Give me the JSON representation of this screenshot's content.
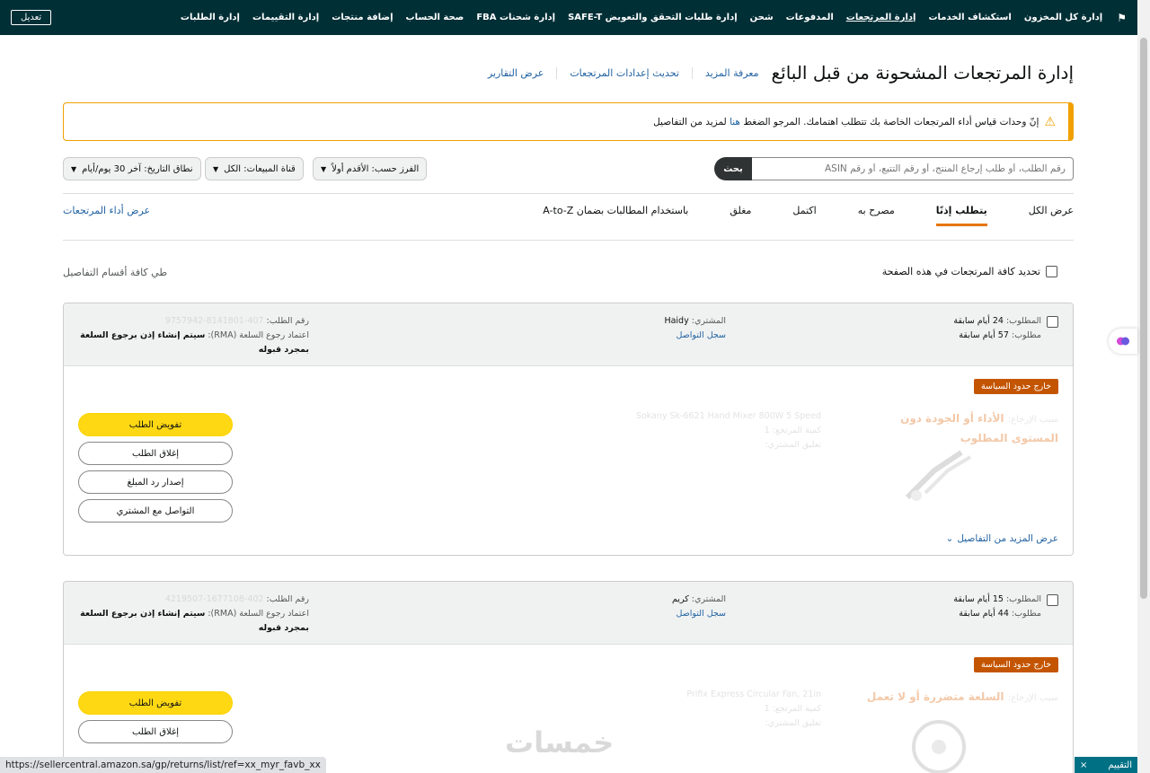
{
  "topnav": {
    "items": [
      "إدارة كل المخزون",
      "استكشاف الخدمات",
      "إدارة المرتجعات",
      "المدفوعات",
      "شحن",
      "إدارة طلبات التحقق والتعويض SAFE-T",
      "إدارة شحنات FBA",
      "صحة الحساب",
      "إضافة منتجات",
      "إدارة التقييمات",
      "إدارة الطلبات"
    ],
    "edit_label": "تعديل"
  },
  "header": {
    "title": "إدارة المرتجعات المشحونة من قبل البائع",
    "learn_more": "معرفة المزيد",
    "update_settings": "تحديث إعدادات المرتجعات",
    "view_reports": "عرض التقارير"
  },
  "alert": {
    "text_before": "إنّ وحدات قياس أداء المرتجعات الخاصة بك تتطلب اهتمامك. المرجو الضغط",
    "link": "هنا",
    "text_after": "لمزيد من التفاصيل"
  },
  "search": {
    "placeholder": "رقم الطلب، أو طلب إرجاع المنتج، أو رقم التتبع، أو رقم ASIN",
    "button": "بحث"
  },
  "filters": {
    "sort": "الفرز حسب: الأقدم أولاً",
    "channel": "قناة المبيعات: الكل",
    "date_range": "نطاق التاريخ: آخر 30 يوم/أيام"
  },
  "tabs": [
    "عرض الكل",
    "يتطلب إذنًا",
    "مصرح به",
    "اكتمل",
    "مغلق",
    "باستخدام المطالبات بضمان A-to-Z"
  ],
  "tab_perf": "عرض أداء المرتجعات",
  "select_all": "تحديد كافة المرتجعات في هذه الصفحة",
  "collapse_all": "طي كافة أقسام التفاصيل",
  "cards": [
    {
      "requested_label": "المطلوب:",
      "requested_value": "24 أيام سابقة",
      "requested2_label": "مطلوب:",
      "requested2_value": "57 أيام سابقة",
      "buyer_label": "المشتري:",
      "buyer_value": "Haidy",
      "contact_history": "سجل التواصل",
      "order_label": "رقم الطلب:",
      "order_value": "407-8141801-9757942",
      "rma_label": "اعتماد رجوع السلعة (RMA):",
      "rma_value": "سيتم إنشاء إذن برجوع السلعة بمجرد قبوله",
      "policy_badge": "خارج حدود السياسة",
      "reason_label": "سبب الإرجاع:",
      "reason_value": "الأداء أو الجودة دون المستوى المطلوب",
      "product_name": "Sokany Sk-6621 Hand Mixer 800W 5 Speed",
      "qty_label": "كمية المرتجع:",
      "qty_value": "1",
      "comment_label": "تعليق المشتري:",
      "more_details": "عرض المزيد من التفاصيل",
      "actions": [
        "تفويض الطلب",
        "إغلاق الطلب",
        "إصدار رد المبلغ",
        "التواصل مع المشتري"
      ]
    },
    {
      "requested_label": "المطلوب:",
      "requested_value": "15 أيام سابقة",
      "requested2_label": "مطلوب:",
      "requested2_value": "44 أيام سابقة",
      "buyer_label": "المشتري:",
      "buyer_value": "كريم",
      "contact_history": "سجل التواصل",
      "order_label": "رقم الطلب:",
      "order_value": "402-1677108-4219507",
      "rma_label": "اعتماد رجوع السلعة (RMA):",
      "rma_value": "سيتم إنشاء إذن برجوع السلعة بمجرد قبوله",
      "policy_badge": "خارج حدود السياسة",
      "reason_label": "سبب الإرجاع:",
      "reason_value": "السلعة متضررة أو لا تعمل",
      "product_name": "Prifix Express Circular Fan, 21in",
      "qty_label": "كمية المرتجع:",
      "qty_value": "1",
      "comment_label": "تعليق المشتري:",
      "actions": [
        "تفويض الطلب",
        "إغلاق الطلب"
      ]
    }
  ],
  "status_url": "https://sellercentral.amazon.sa/gp/returns/list/ref=xx_myr_favb_xx",
  "watermark": "خمسات",
  "feedback": "التقييم",
  "colors": {
    "nav_bg": "#002f36",
    "link": "#2162a1",
    "alert": "#f0a000",
    "policy": "#c45500",
    "primary_btn": "#ffd814",
    "tab_underline": "#e77600"
  }
}
